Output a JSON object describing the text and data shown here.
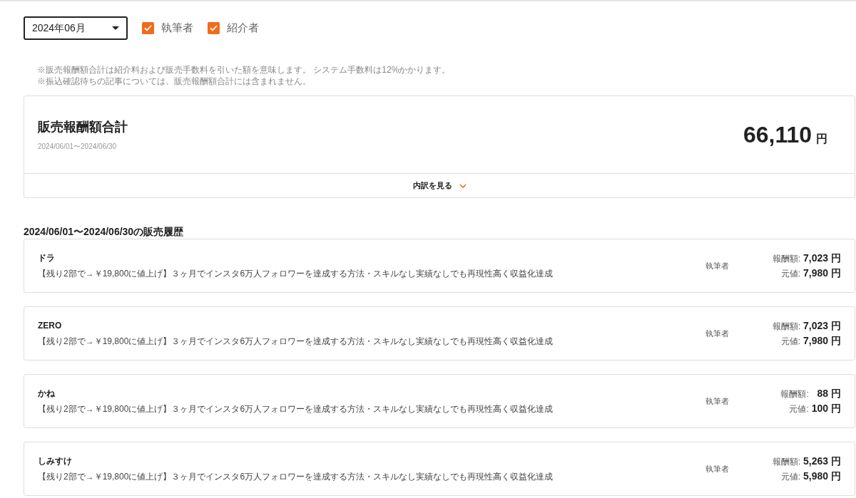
{
  "filters": {
    "month": "2024年06月",
    "checkboxes": [
      {
        "label": "執筆者",
        "checked": true
      },
      {
        "label": "紹介者",
        "checked": true
      }
    ]
  },
  "notes": [
    "※販売報酬額合計は紹介料および販売手数料を引いた額を意味します。 システム手数料は12%かかります。",
    "※振込確認待ちの記事については、販売報酬額合計には含まれません。"
  ],
  "summary": {
    "title": "販売報酬額合計",
    "period": "2024/06/01〜2024/06/30",
    "amount": "66,110",
    "unit": "円",
    "breakdown_label": "内訳を見る",
    "expanded": false
  },
  "history": {
    "title": "2024/06/01〜2024/06/30の販売履歴",
    "items": [
      {
        "buyer": "ドラ",
        "article": "【残り2部で→￥19,800に値上げ】３ヶ月でインスタ6万人フォロワーを達成する方法・スキルなし実績なしでも再現性高く収益化達成",
        "role": "執筆者",
        "reward_label": "報酬額:",
        "reward": "7,023 円",
        "price_label": "元値:",
        "price": "7,980 円"
      },
      {
        "buyer": "ZERO",
        "article": "【残り2部で→￥19,800に値上げ】３ヶ月でインスタ6万人フォロワーを達成する方法・スキルなし実績なしでも再現性高く収益化達成",
        "role": "執筆者",
        "reward_label": "報酬額:",
        "reward": "7,023 円",
        "price_label": "元値:",
        "price": "7,980 円"
      },
      {
        "buyer": "かね",
        "article": "【残り2部で→￥19,800に値上げ】３ヶ月でインスタ6万人フォロワーを達成する方法・スキルなし実績なしでも再現性高く収益化達成",
        "role": "執筆者",
        "reward_label": "報酬額:",
        "reward": "88 円",
        "price_label": "元値:",
        "price": "100 円"
      },
      {
        "buyer": "しみすけ",
        "article": "【残り2部で→￥19,800に値上げ】３ヶ月でインスタ6万人フォロワーを達成する方法・スキルなし実績なしでも再現性高く収益化達成",
        "role": "執筆者",
        "reward_label": "報酬額:",
        "reward": "5,263 円",
        "price_label": "元値:",
        "price": "5,980 円"
      }
    ]
  }
}
